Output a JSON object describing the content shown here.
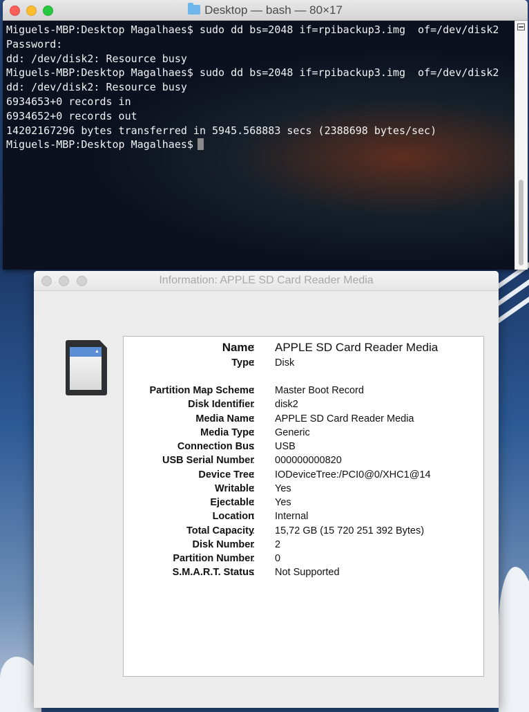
{
  "terminal": {
    "title": "Desktop — bash — 80×17",
    "lines": [
      "Miguels-MBP:Desktop Magalhaes$ sudo dd bs=2048 if=rpibackup3.img  of=/dev/disk2",
      "Password:",
      "dd: /dev/disk2: Resource busy",
      "Miguels-MBP:Desktop Magalhaes$ sudo dd bs=2048 if=rpibackup3.img  of=/dev/disk2",
      "dd: /dev/disk2: Resource busy",
      "6934653+0 records in",
      "6934652+0 records out",
      "14202167296 bytes transferred in 5945.568883 secs (2388698 bytes/sec)"
    ],
    "prompt": "Miguels-MBP:Desktop Magalhaes$"
  },
  "info": {
    "title": "Information: APPLE SD Card Reader Media",
    "colon": ":",
    "rows": [
      {
        "label": "Name",
        "value": "APPLE SD Card Reader Media"
      },
      {
        "label": "Type",
        "value": "Disk"
      },
      {
        "label": "Partition Map Scheme",
        "value": "Master Boot Record"
      },
      {
        "label": "Disk Identifier",
        "value": "disk2"
      },
      {
        "label": "Media Name",
        "value": "APPLE SD Card Reader Media"
      },
      {
        "label": "Media Type",
        "value": "Generic"
      },
      {
        "label": "Connection Bus",
        "value": "USB"
      },
      {
        "label": "USB Serial Number",
        "value": "000000000820"
      },
      {
        "label": "Device Tree",
        "value": "IODeviceTree:/PCI0@0/XHC1@14"
      },
      {
        "label": "Writable",
        "value": "Yes"
      },
      {
        "label": "Ejectable",
        "value": "Yes"
      },
      {
        "label": "Location",
        "value": "Internal"
      },
      {
        "label": "Total Capacity",
        "value": "15,72 GB (15 720 251 392 Bytes)"
      },
      {
        "label": "Disk Number",
        "value": "2"
      },
      {
        "label": "Partition Number",
        "value": "0"
      },
      {
        "label": "S.M.A.R.T. Status",
        "value": "Not Supported"
      }
    ]
  }
}
